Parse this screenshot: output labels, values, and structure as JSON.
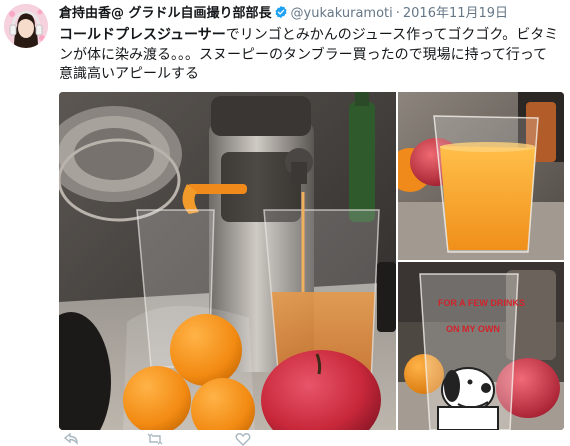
{
  "author": {
    "name": "倉持由香@ グラドル自画撮り部部長",
    "handle": "@yukakuramoti",
    "verified_icon": "verified-badge-icon"
  },
  "timestamp": "2016年11月19日",
  "separator": "·",
  "text": {
    "line1_highlight": "コールドプレスジューサー",
    "line1_rest": "でリンゴとみかんのジュース作ってゴクゴク。ビタミ",
    "line2": "ンが体に染み渡る。。。スヌーピーのタンブラー買ったので現場に持って行って",
    "line3": "意識高いアピールする"
  },
  "media": {
    "photos": [
      {
        "name": "juicer-with-oranges-and-apple-photo"
      },
      {
        "name": "orange-juice-glass-photo"
      },
      {
        "name": "snoopy-tumbler-photo"
      }
    ],
    "cup_lettering": "FOR A FEW DRINKS / ON MY OWN"
  },
  "colors": {
    "text": "#14171a",
    "muted": "#657786",
    "verified": "#1da1f2",
    "juice": "#f0a23a",
    "apple": "#c8283a"
  }
}
